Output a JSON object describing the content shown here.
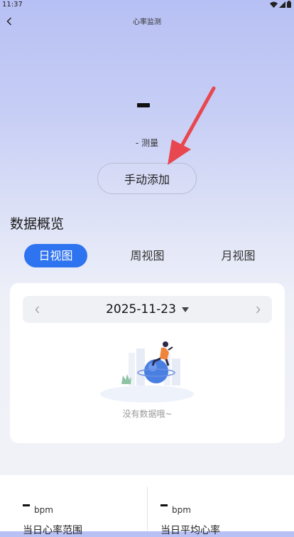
{
  "status_bar": {
    "time": "11:37",
    "icons": [
      "wifi-icon",
      "signal-icon",
      "battery-icon"
    ]
  },
  "nav": {
    "title": "心率监测",
    "back_icon": "chevron-left-icon"
  },
  "measurement": {
    "value": "-",
    "label": "- 测量"
  },
  "manual_add_label": "手动添加",
  "overview": {
    "title": "数据概览",
    "tabs": [
      {
        "label": "日视图",
        "active": true
      },
      {
        "label": "周视图",
        "active": false
      },
      {
        "label": "月视图",
        "active": false
      }
    ]
  },
  "day_card": {
    "date": "2025-11-23",
    "empty_text": "没有数据哦~",
    "icons": {
      "prev": "chevron-left-icon",
      "next": "chevron-right-icon",
      "dropdown": "caret-down-icon"
    }
  },
  "stats": {
    "range": {
      "value": "-",
      "unit": "bpm",
      "label": "当日心率范围"
    },
    "average": {
      "value": "-",
      "unit": "bpm",
      "label": "当日平均心率"
    }
  },
  "colors": {
    "accent": "#2e73f0",
    "arrow": "#e8474f"
  }
}
